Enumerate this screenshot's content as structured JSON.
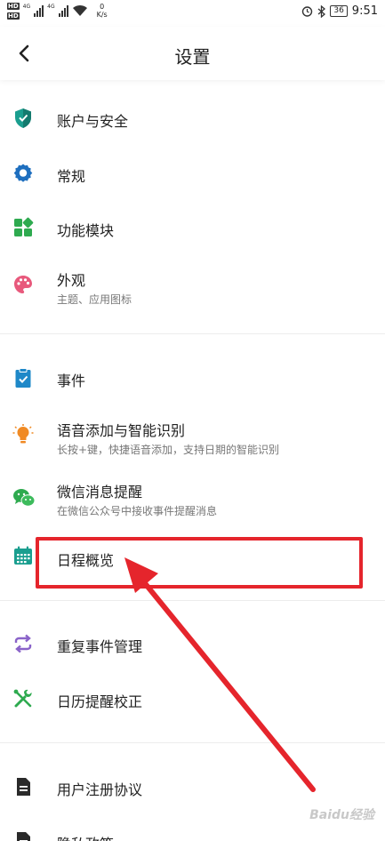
{
  "status_bar": {
    "hd1": "HD",
    "hd2": "HD",
    "net1": "4G",
    "net2": "4G",
    "speed_value": "0",
    "speed_unit": "K/s",
    "battery": "36",
    "time": "9:51"
  },
  "header": {
    "title": "设置"
  },
  "items": [
    {
      "label": "账户与安全",
      "icon": "shield-icon"
    },
    {
      "label": "常规",
      "icon": "gear-icon"
    },
    {
      "label": "功能模块",
      "icon": "modules-icon"
    },
    {
      "label": "外观",
      "sub": "主题、应用图标",
      "icon": "palette-icon"
    },
    {
      "label": "事件",
      "icon": "clipboard-check-icon"
    },
    {
      "label": "语音添加与智能识别",
      "sub": "长按+键，快捷语音添加，支持日期的智能识别",
      "icon": "bulb-icon"
    },
    {
      "label": "微信消息提醒",
      "sub": "在微信公众号中接收事件提醒消息",
      "icon": "wechat-icon"
    },
    {
      "label": "日程概览",
      "icon": "calendar-icon"
    },
    {
      "label": "重复事件管理",
      "icon": "repeat-icon"
    },
    {
      "label": "日历提醒校正",
      "icon": "tools-icon"
    },
    {
      "label": "用户注册协议",
      "icon": "document-icon"
    },
    {
      "label": "隐私政策",
      "icon": "document-icon"
    }
  ],
  "watermark": "Baidu经验",
  "colors": {
    "accent_red": "#e5252c",
    "teal": "#1a9e8f",
    "blue": "#1e6fbf",
    "green": "#2eaa4f",
    "pink": "#e8597c",
    "orange": "#f08a24",
    "purple": "#8a63c9"
  }
}
